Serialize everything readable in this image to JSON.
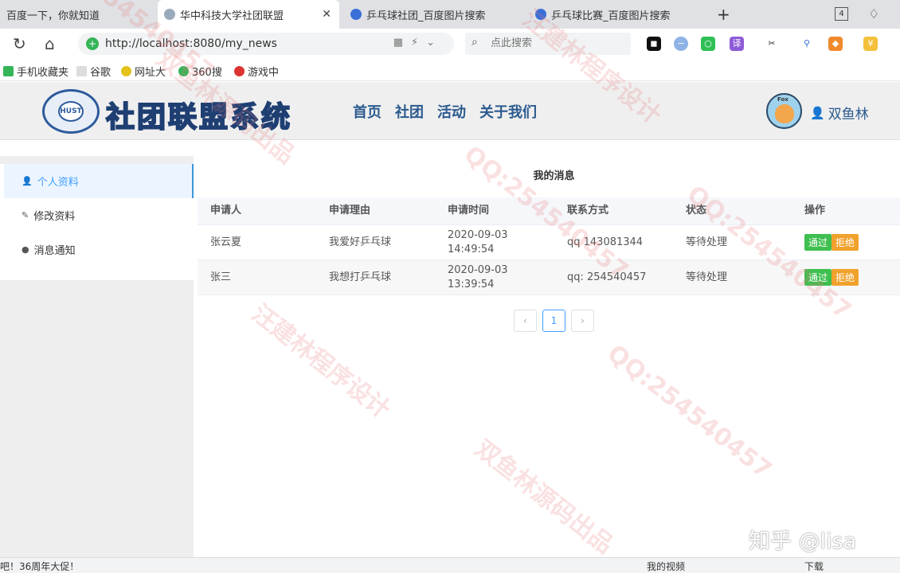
{
  "browser": {
    "tabs": [
      {
        "label": "百度一下，你就知道",
        "active": false
      },
      {
        "label": "华中科技大学社团联盟",
        "active": true
      },
      {
        "label": "乒乓球社团_百度图片搜索",
        "active": false
      },
      {
        "label": "乒乓球比赛_百度图片搜索",
        "active": false
      }
    ],
    "tab_count": "4",
    "url": "http://localhost:8080/my_news",
    "search_placeholder": "点此搜索",
    "bookmarks": [
      "手机收藏夹",
      "谷歌",
      "网址大",
      "360搜",
      "游戏中"
    ]
  },
  "header": {
    "logo_title": "社团联盟系统",
    "nav": [
      "首页",
      "社团",
      "活动",
      "关于我们"
    ],
    "user_name": "双鱼林",
    "avatar_tag": "Fox"
  },
  "sidebar": {
    "items": [
      {
        "label": "个人资料",
        "active": true
      },
      {
        "label": "修改资料",
        "active": false
      },
      {
        "label": "消息通知",
        "active": false
      }
    ]
  },
  "main": {
    "title": "我的消息",
    "columns": [
      "申请人",
      "申请理由",
      "申请时间",
      "联系方式",
      "状态",
      "操作"
    ],
    "rows": [
      {
        "applicant": "张云夏",
        "reason": "我爱好乒乓球",
        "time": "2020-09-03 14:49:54",
        "contact": "qq 143081344",
        "status": "等待处理"
      },
      {
        "applicant": "张三",
        "reason": "我想打乒乓球",
        "time": "2020-09-03 13:39:54",
        "contact": "qq: 254540457",
        "status": "等待处理"
      }
    ],
    "approve_label": "通过",
    "reject_label": "拒绝",
    "pagination": {
      "current": "1",
      "prev": "‹",
      "next": "›"
    }
  },
  "watermarks": [
    "QQ:254540457",
    "汪建林程序设计",
    "双鱼林源码出品"
  ],
  "corner_watermark": "知乎 @lisa",
  "statusbar": {
    "left": "吧！36周年大促！",
    "right1": "我的视频",
    "right2": "下载"
  },
  "colors": {
    "accent": "#409eff",
    "approve": "#3fbf4f",
    "reject": "#f0a22c",
    "nav_text": "#2b5a8f"
  }
}
